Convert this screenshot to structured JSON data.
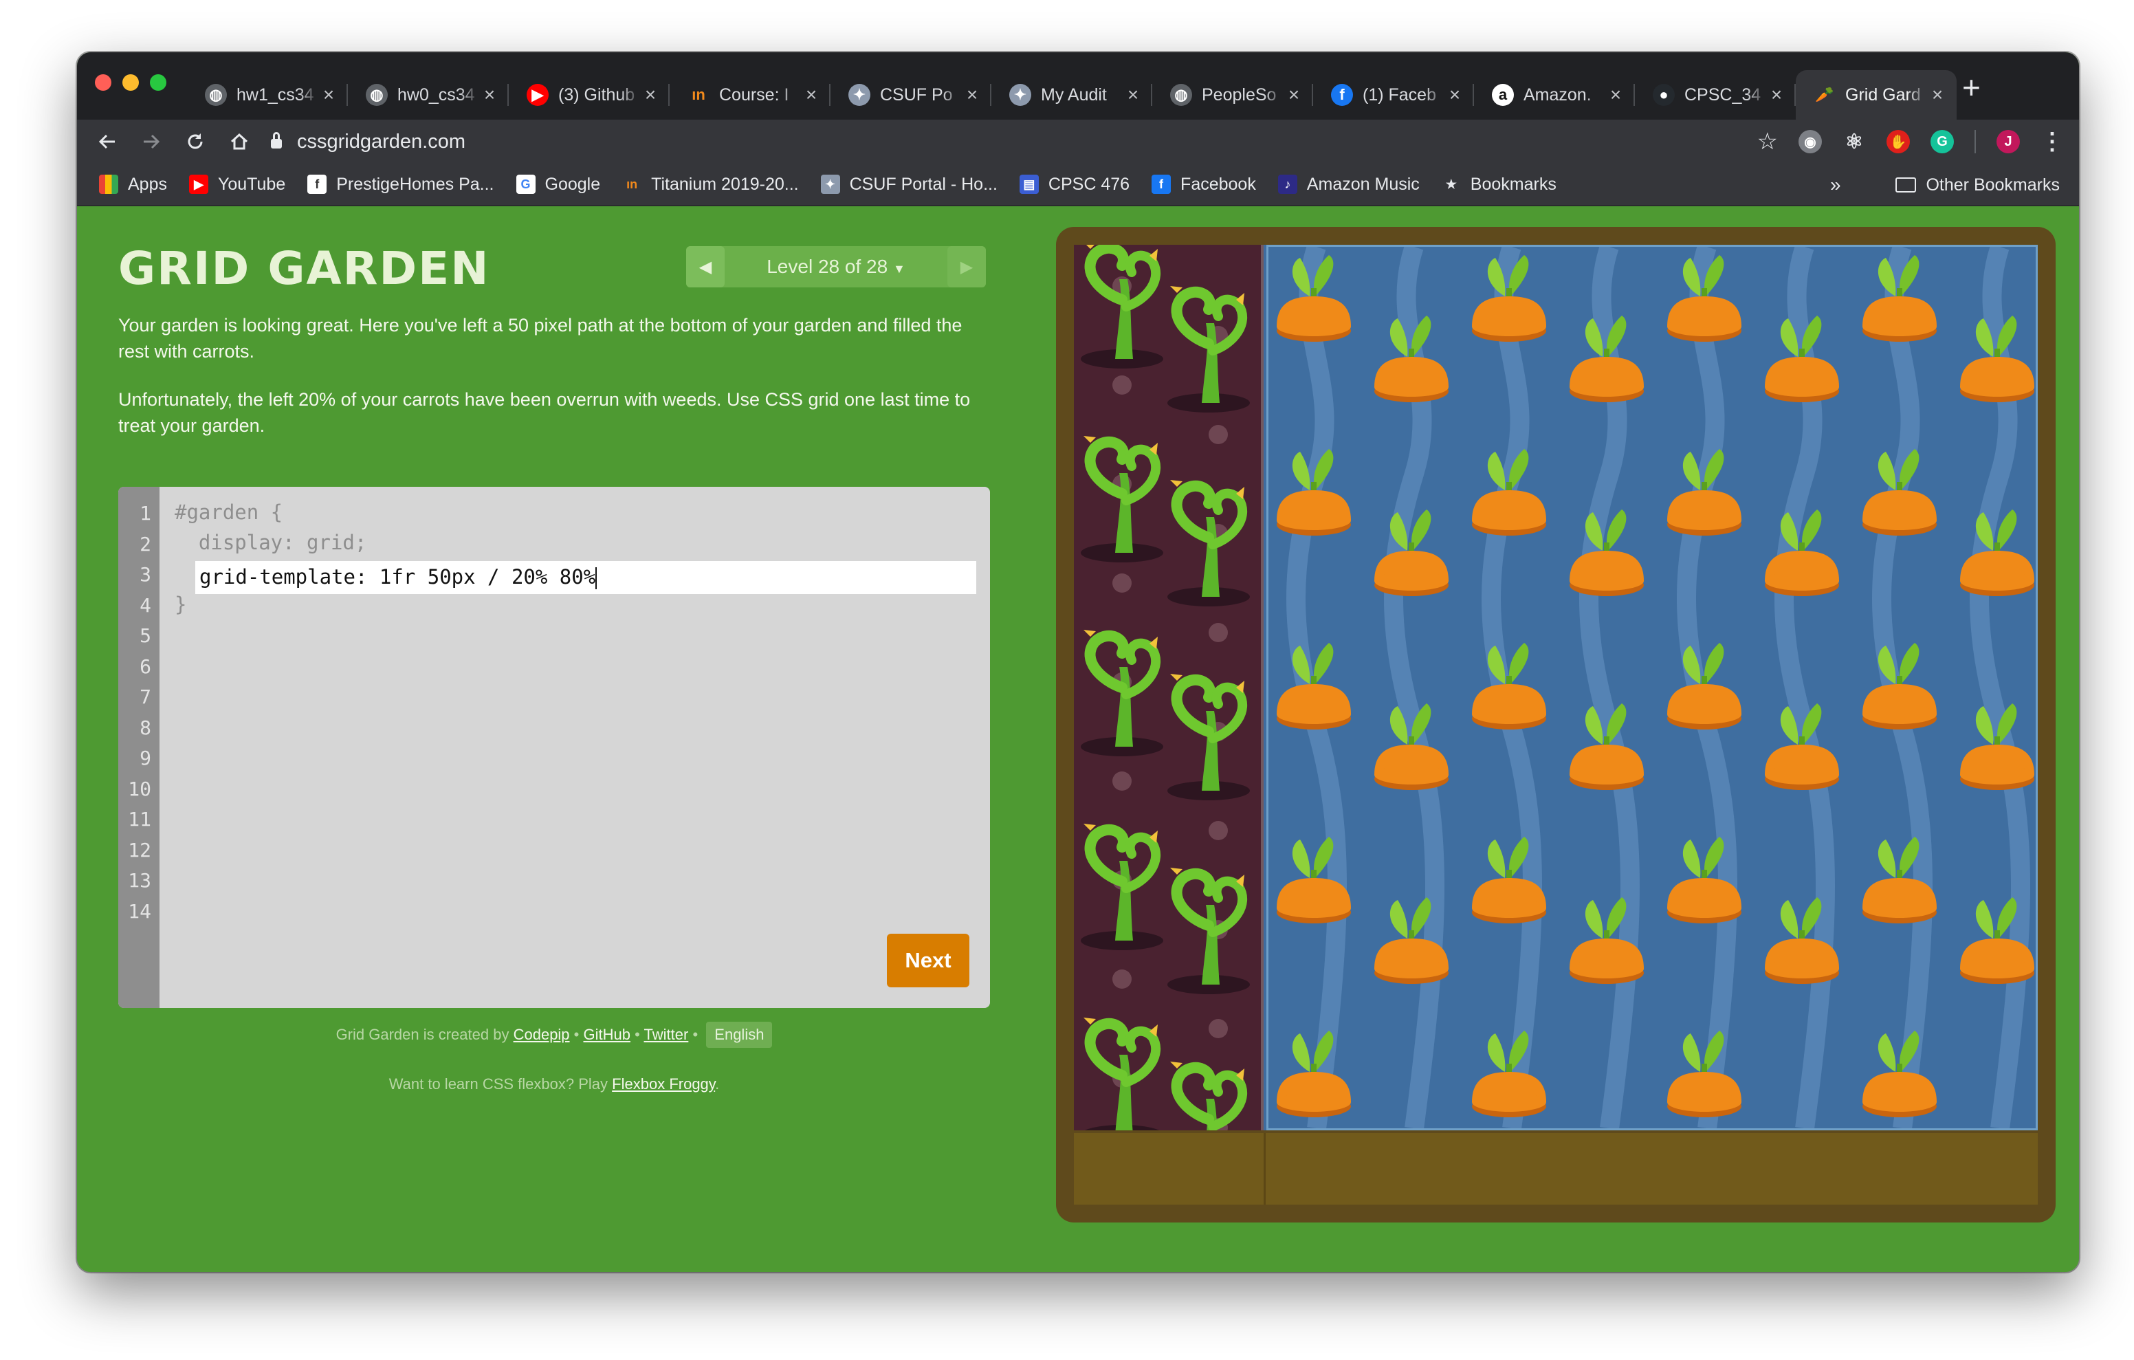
{
  "browser": {
    "tabs": [
      {
        "title": "hw1_cs34",
        "icon": "globe-icon"
      },
      {
        "title": "hw0_cs34",
        "icon": "globe-icon"
      },
      {
        "title": "(3) Github",
        "icon": "youtube-icon"
      },
      {
        "title": "Course: I",
        "icon": "titanium-icon"
      },
      {
        "title": "CSUF Po",
        "icon": "csuf-icon"
      },
      {
        "title": "My Audit",
        "icon": "csuf-icon"
      },
      {
        "title": "PeopleSo",
        "icon": "globe-icon"
      },
      {
        "title": "(1) Faceb",
        "icon": "facebook-icon"
      },
      {
        "title": "Amazon.",
        "icon": "amazon-icon"
      },
      {
        "title": "CPSC_34",
        "icon": "github-icon"
      },
      {
        "title": "Grid Gard",
        "icon": "carrot-icon",
        "active": true
      }
    ],
    "url": "cssgridgarden.com",
    "bookmarks": [
      {
        "label": "Apps",
        "icon": "apps-grid-icon"
      },
      {
        "label": "YouTube",
        "icon": "youtube-icon"
      },
      {
        "label": "PrestigeHomes Pa...",
        "icon": "page-icon"
      },
      {
        "label": "Google",
        "icon": "google-icon"
      },
      {
        "label": "Titanium 2019-20...",
        "icon": "titanium-icon"
      },
      {
        "label": "CSUF Portal - Ho...",
        "icon": "csuf-icon"
      },
      {
        "label": "CPSC 476",
        "icon": "calendar-icon"
      },
      {
        "label": "Facebook",
        "icon": "facebook-icon"
      },
      {
        "label": "Amazon Music",
        "icon": "amazon-music-icon"
      },
      {
        "label": "Bookmarks",
        "icon": "star-icon"
      }
    ],
    "overflow": "»",
    "other_bookmarks": "Other Bookmarks",
    "profile_initial": "J"
  },
  "game": {
    "title": "GRID GARDEN",
    "level": "Level 28 of 28",
    "paragraph1": "Your garden is looking great. Here you've left a 50 pixel path at the bottom of your garden and filled the rest with carrots.",
    "paragraph2": "Unfortunately, the left 20% of your carrots have been overrun with weeds. Use CSS grid one last time to treat your garden.",
    "line_numbers": [
      "1",
      "2",
      "3",
      "4",
      "5",
      "6",
      "7",
      "8",
      "9",
      "10",
      "11",
      "12",
      "13",
      "14"
    ],
    "code_line1": "#garden {",
    "code_line2": "  display: grid;",
    "code_input": "grid-template: 1fr 50px / 20% 80%",
    "code_line4": "}",
    "next_label": "Next",
    "credit_prefix": "Grid Garden is created by",
    "credit_codepip": "Codepip",
    "credit_github": "GitHub",
    "credit_twitter": "Twitter",
    "separator": "•",
    "language": "English",
    "flexbox_prefix": "Want to learn CSS flexbox? Play",
    "flexbox_link": "Flexbox Froggy",
    "flexbox_suffix": "."
  },
  "colors": {
    "page_green": "#4e9a32",
    "soil": "#5f4a1c",
    "water": "#3f6ea0",
    "weed_soil": "#4a2230",
    "carrot": "#f08a18",
    "leaf": "#77c12a",
    "next_button": "#d87d00"
  }
}
